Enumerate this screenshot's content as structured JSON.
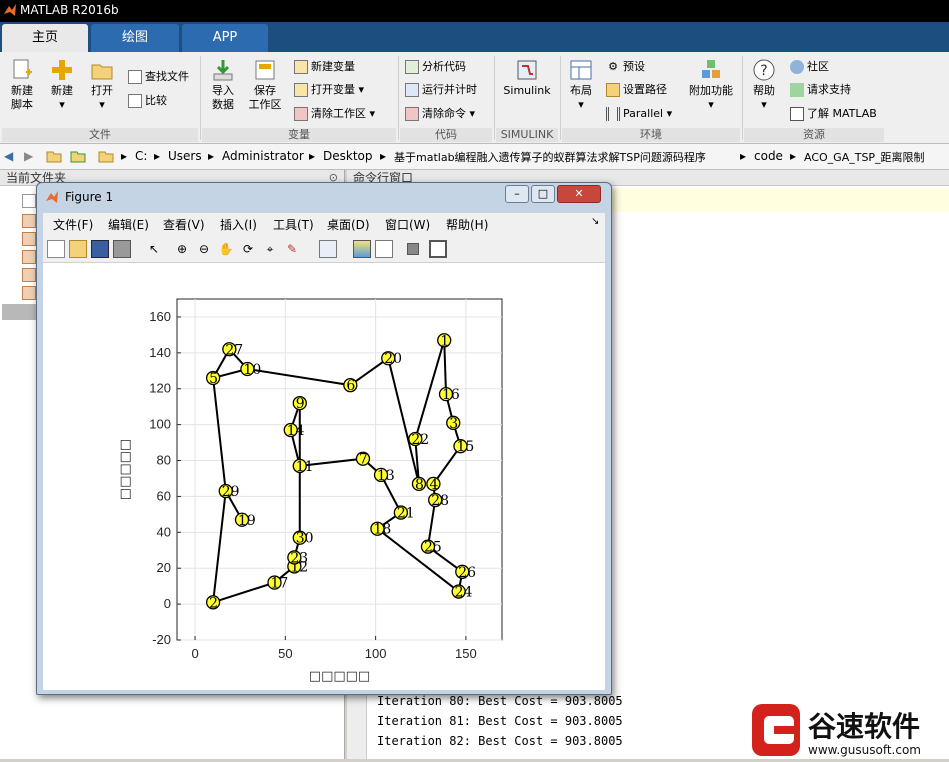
{
  "window": {
    "title": "MATLAB R2016b"
  },
  "tabs": [
    {
      "label": "主页"
    },
    {
      "label": "绘图"
    },
    {
      "label": "APP"
    }
  ],
  "ribbon": {
    "new_script": "新建\n脚本",
    "new_script_a": "新建",
    "new_script_b": "脚本",
    "new": "新建",
    "open": "打开",
    "find_files": "查找文件",
    "compare": "比较",
    "import_a": "导入",
    "import_b": "数据",
    "save_ws_a": "保存",
    "save_ws_b": "工作区",
    "new_var": "新建变量",
    "open_var": "打开变量",
    "clear_ws": "清除工作区",
    "analyze_code": "分析代码",
    "run_time": "运行并计时",
    "clear_cmd": "清除命令",
    "simulink": "Simulink",
    "layout": "布局",
    "prefs": "预设",
    "set_path": "设置路径",
    "parallel": "Parallel",
    "addons": "附加功能",
    "help": "帮助",
    "community": "社区",
    "support": "请求支持",
    "learn": "了解 MATLAB",
    "groups": {
      "file": "文件",
      "variable": "变量",
      "code": "代码",
      "simulink": "SIMULINK",
      "env": "环境",
      "resources": "资源"
    }
  },
  "address": {
    "crumbs": [
      "C:",
      "Users",
      "Administrator",
      "Desktop",
      "基于matlab编程融入遗传算子的蚁群算法求解TSP问题源码程序",
      "code",
      "ACO_GA_TSP_距离限制"
    ]
  },
  "panels": {
    "current_folder": "当前文件夹",
    "command_window": "命令行窗口"
  },
  "command_output": [
    "Iteration 80: Best Cost = 903.8005",
    "Iteration 81: Best Cost = 903.8005",
    "Iteration 82: Best Cost = 903.8005"
  ],
  "figure": {
    "title": "Figure 1",
    "menu": [
      "文件(F)",
      "编辑(E)",
      "查看(V)",
      "插入(I)",
      "工具(T)",
      "桌面(D)",
      "窗口(W)",
      "帮助(H)"
    ]
  },
  "chart_data": {
    "type": "line",
    "title": "",
    "xlabel": "□□□□□",
    "ylabel": "□□□□□",
    "xlim": [
      -10,
      170
    ],
    "ylim": [
      -20,
      170
    ],
    "xticks": [
      0,
      50,
      100,
      150
    ],
    "yticks": [
      -20,
      0,
      20,
      40,
      60,
      80,
      100,
      120,
      140,
      160
    ],
    "grid": true,
    "points": [
      {
        "id": "1",
        "x": 138,
        "y": 147
      },
      {
        "id": "2",
        "x": 10,
        "y": 1
      },
      {
        "id": "3",
        "x": 143,
        "y": 101
      },
      {
        "id": "4",
        "x": 132,
        "y": 67
      },
      {
        "id": "5",
        "x": 10,
        "y": 126
      },
      {
        "id": "6",
        "x": 86,
        "y": 122
      },
      {
        "id": "7",
        "x": 93,
        "y": 81
      },
      {
        "id": "8",
        "x": 124,
        "y": 67
      },
      {
        "id": "9",
        "x": 58,
        "y": 112
      },
      {
        "id": "10",
        "x": 29,
        "y": 131
      },
      {
        "id": "11",
        "x": 58,
        "y": 77
      },
      {
        "id": "12",
        "x": 55,
        "y": 21
      },
      {
        "id": "13",
        "x": 103,
        "y": 72
      },
      {
        "id": "14",
        "x": 53,
        "y": 97
      },
      {
        "id": "15",
        "x": 147,
        "y": 88
      },
      {
        "id": "16",
        "x": 139,
        "y": 117
      },
      {
        "id": "17",
        "x": 44,
        "y": 12
      },
      {
        "id": "18",
        "x": 101,
        "y": 42
      },
      {
        "id": "19",
        "x": 26,
        "y": 47
      },
      {
        "id": "20",
        "x": 107,
        "y": 137
      },
      {
        "id": "21",
        "x": 114,
        "y": 51
      },
      {
        "id": "22",
        "x": 122,
        "y": 92
      },
      {
        "id": "23",
        "x": 55,
        "y": 26
      },
      {
        "id": "24",
        "x": 146,
        "y": 7
      },
      {
        "id": "25",
        "x": 129,
        "y": 32
      },
      {
        "id": "26",
        "x": 148,
        "y": 18
      },
      {
        "id": "27",
        "x": 19,
        "y": 142
      },
      {
        "id": "28",
        "x": 133,
        "y": 58
      },
      {
        "id": "29",
        "x": 17,
        "y": 63
      },
      {
        "id": "30",
        "x": 58,
        "y": 37
      }
    ],
    "route": [
      "2",
      "17",
      "12",
      "23",
      "30",
      "11",
      "9",
      "14",
      "11",
      "7",
      "13",
      "21",
      "18",
      "24",
      "26",
      "25",
      "28",
      "4",
      "15",
      "3",
      "16",
      "1",
      "22",
      "8",
      "20",
      "6",
      "10",
      "5",
      "27",
      "10",
      "5",
      "29",
      "19",
      "29",
      "2"
    ],
    "line_color": "#000000",
    "marker_color": "#ffff33"
  }
}
